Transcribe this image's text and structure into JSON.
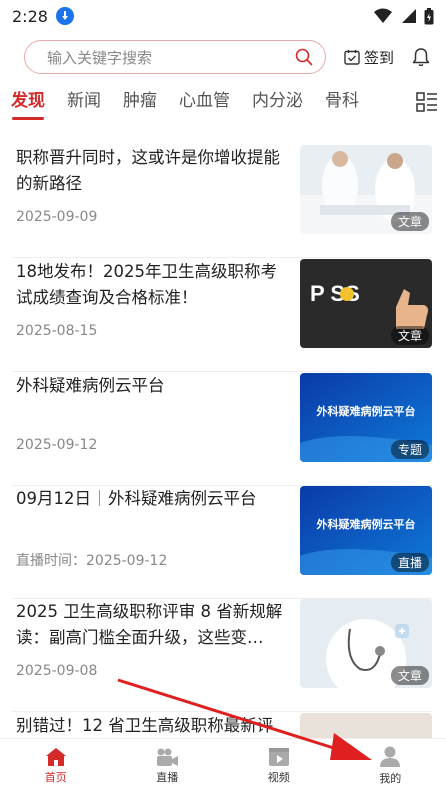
{
  "status_bar": {
    "time": "2:28"
  },
  "search": {
    "placeholder": "输入关键字搜索",
    "checkin_label": "签到"
  },
  "tabs": [
    "发现",
    "新闻",
    "肿瘤",
    "心血管",
    "内分泌",
    "骨科"
  ],
  "articles": [
    {
      "title": "职称晋升同时，这或许是你增收提能的新路径",
      "meta": "2025-09-09",
      "badge": "文章"
    },
    {
      "title": "18地发布！2025年卫生高级职称考试成绩查询及合格标准！",
      "meta": "2025-08-15",
      "badge": "文章",
      "thumb_text": "P SS"
    },
    {
      "title": "外科疑难病例云平台",
      "meta": "2025-09-12",
      "badge": "专题",
      "thumb_text": "外科疑难病例云平台"
    },
    {
      "title_prefix": "09月12日",
      "title": "外科疑难病例云平台",
      "meta": "直播时间：2025-09-12",
      "badge": "直播",
      "thumb_text": "外科疑难病例云平台"
    },
    {
      "title": "2025 卫生高级职称评审 8 省新规解读：副高门槛全面升级，这些变…",
      "meta": "2025-09-08",
      "badge": "文章"
    },
    {
      "title": "别错过！12 省卫生高级职称最新评"
    }
  ],
  "bottom_nav": [
    {
      "label": "首页",
      "icon": "home-icon",
      "active": true
    },
    {
      "label": "直播",
      "icon": "camera-icon",
      "active": false
    },
    {
      "label": "视频",
      "icon": "play-icon",
      "active": false
    },
    {
      "label": "我的",
      "icon": "user-icon",
      "active": false
    }
  ],
  "colors": {
    "accent": "#d42a2a",
    "annotation_arrow": "#e02020"
  }
}
